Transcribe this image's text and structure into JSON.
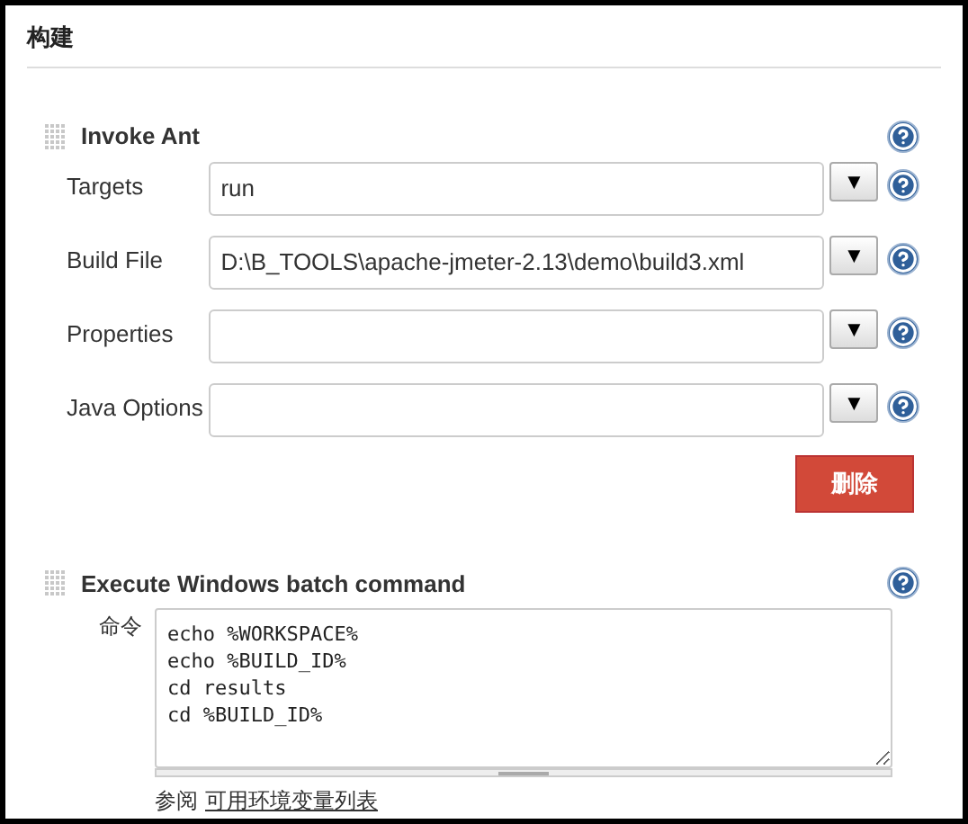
{
  "section_title": "构建",
  "steps": [
    {
      "kind": "ant",
      "title": "Invoke Ant",
      "fields": [
        {
          "label": "Targets",
          "value": "run",
          "dropdown": "▼"
        },
        {
          "label": "Build File",
          "value": "D:\\B_TOOLS\\apache-jmeter-2.13\\demo\\build3.xml",
          "dropdown": "▼"
        },
        {
          "label": "Properties",
          "dropdown": "▼"
        },
        {
          "label": "Java Options",
          "dropdown": "▼"
        }
      ],
      "delete_button": "删除"
    },
    {
      "kind": "batch",
      "title": "Execute Windows batch command",
      "command_label": "命令",
      "command_lines": [
        "echo %WORKSPACE%",
        "echo %BUILD_ID%",
        "cd results",
        "cd %BUILD_ID%"
      ],
      "see_also": "参阅",
      "link": "可用环境变量列表"
    }
  ]
}
